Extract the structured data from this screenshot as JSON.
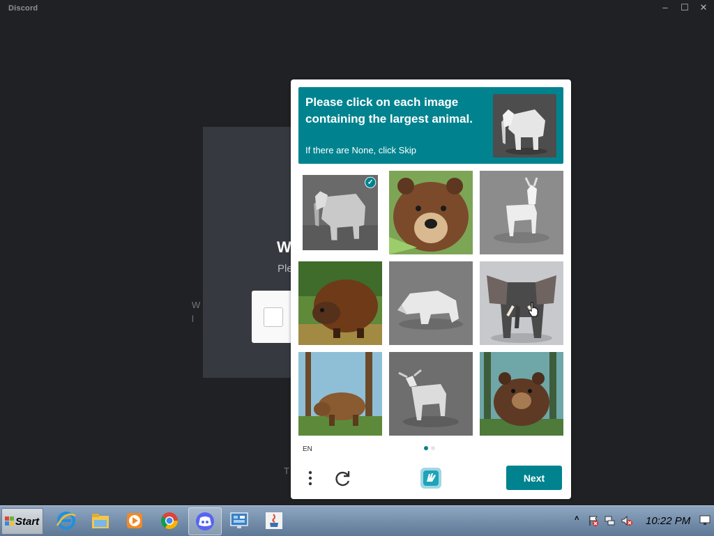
{
  "window": {
    "title": "Discord",
    "controls": {
      "minimize": "–",
      "maximize": "☐",
      "close": "✕"
    }
  },
  "background_modal": {
    "heading": "W",
    "subtitle": "Ple",
    "body_line1": "W",
    "body_line2": "l",
    "bottom_text": "T"
  },
  "captcha": {
    "prompt": {
      "title": "Please click on each image containing the largest animal.",
      "hint": "If there are None, click Skip",
      "example_icon": "elephant-lowpoly-example"
    },
    "tiles": [
      {
        "subject": "lowpoly elephant",
        "selected": true
      },
      {
        "subject": "painted brown bear",
        "selected": false
      },
      {
        "subject": "white goat",
        "selected": false
      },
      {
        "subject": "painted beaver",
        "selected": false
      },
      {
        "subject": "lowpoly white bear",
        "selected": false
      },
      {
        "subject": "elephant",
        "selected": false
      },
      {
        "subject": "bear in forest",
        "selected": false
      },
      {
        "subject": "white goat",
        "selected": false
      },
      {
        "subject": "brown bear in forest",
        "selected": false
      }
    ],
    "language": "EN",
    "page_indicator": {
      "current": 1,
      "total": 2
    },
    "next_label": "Next",
    "colors": {
      "accent": "#00838f"
    }
  },
  "taskbar": {
    "start_label": "Start",
    "apps": [
      "internet-explorer",
      "file-explorer",
      "media-player",
      "chrome",
      "discord",
      "control-panel",
      "java"
    ],
    "active_app": "discord",
    "tray": {
      "time": "10:22 PM",
      "arrow": "˄"
    }
  }
}
